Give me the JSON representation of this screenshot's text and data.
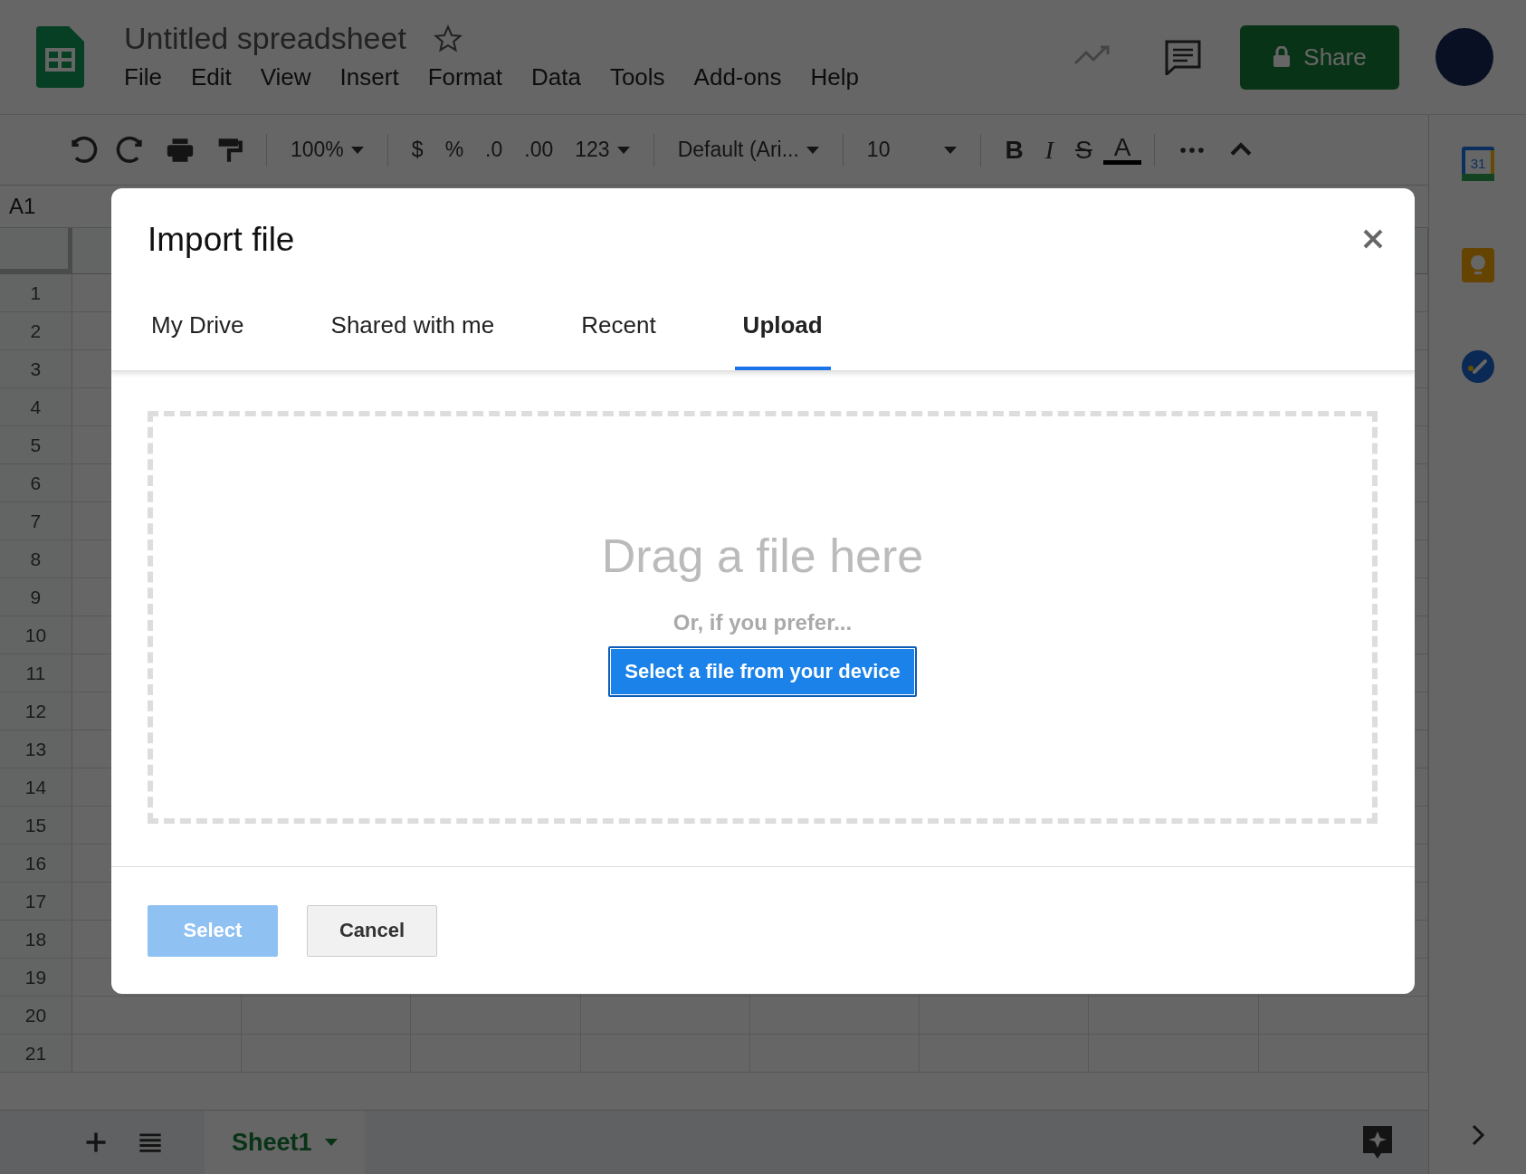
{
  "document": {
    "title": "Untitled spreadsheet"
  },
  "menu": [
    "File",
    "Edit",
    "View",
    "Insert",
    "Format",
    "Data",
    "Tools",
    "Add-ons",
    "Help"
  ],
  "share_button": {
    "label": "Share"
  },
  "toolbar": {
    "zoom": "100%",
    "currency": "$",
    "percent": "%",
    "decrease_decimals": ".0",
    "increase_decimals": ".00",
    "number_format": "123",
    "font": "Default (Ari...",
    "font_size": "10",
    "bold": "B",
    "italic": "I",
    "strikethrough": "S",
    "text_color": "A"
  },
  "name_box": "A1",
  "row_numbers": [
    "1",
    "2",
    "3",
    "4",
    "5",
    "6",
    "7",
    "8",
    "9",
    "10",
    "11",
    "12",
    "13",
    "14",
    "15",
    "16",
    "17",
    "18",
    "19",
    "20",
    "21"
  ],
  "side_panel": {
    "calendar_day": "31"
  },
  "sheet_tabs": [
    {
      "label": "Sheet1",
      "selected": true
    }
  ],
  "dialog": {
    "title": "Import file",
    "tabs": [
      {
        "label": "My Drive",
        "selected": false
      },
      {
        "label": "Shared with me",
        "selected": false
      },
      {
        "label": "Recent",
        "selected": false
      },
      {
        "label": "Upload",
        "selected": true
      }
    ],
    "drop_zone": {
      "heading": "Drag a file here",
      "hint": "Or, if you prefer...",
      "button": "Select a file from your device"
    },
    "buttons": [
      {
        "label": "Select",
        "kind": "primary",
        "disabled": true
      },
      {
        "label": "Cancel",
        "kind": "secondary",
        "disabled": false
      }
    ]
  }
}
